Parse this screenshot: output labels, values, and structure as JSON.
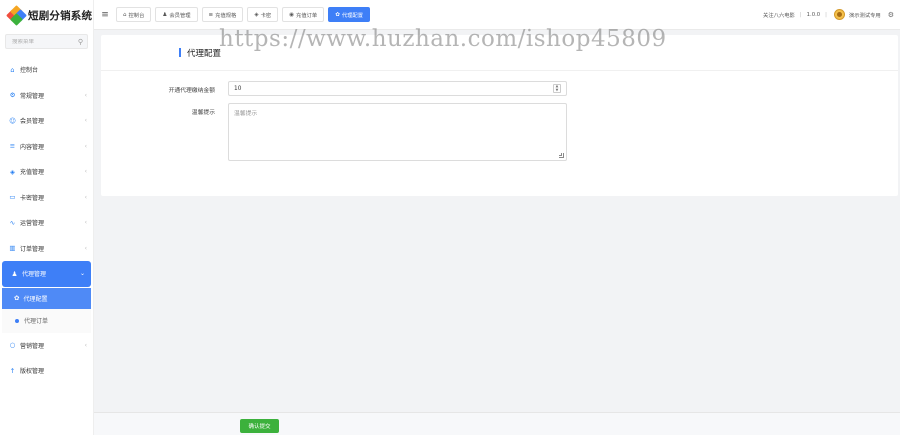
{
  "app": {
    "title": "短剧分销系统",
    "logo_colors": [
      "#f04e3e",
      "#f5a623",
      "#3e7ff7",
      "#3cb13c"
    ]
  },
  "sidebar": {
    "search_placeholder": "搜索菜单",
    "items": [
      {
        "label": "控制台",
        "icon": "home-icon",
        "glyph": "⌂",
        "has_children": false
      },
      {
        "label": "常规管理",
        "icon": "cogs-icon",
        "glyph": "⚙",
        "has_children": true
      },
      {
        "label": "会员管理",
        "icon": "user-icon",
        "glyph": "☺",
        "has_children": true
      },
      {
        "label": "内容管理",
        "icon": "list-icon",
        "glyph": "≡",
        "has_children": true
      },
      {
        "label": "充值管理",
        "icon": "diamond-icon",
        "glyph": "◈",
        "has_children": true
      },
      {
        "label": "卡密管理",
        "icon": "card-icon",
        "glyph": "▭",
        "has_children": true
      },
      {
        "label": "运营管理",
        "icon": "chart-line-icon",
        "glyph": "∿",
        "has_children": true
      },
      {
        "label": "订单管理",
        "icon": "bar-chart-icon",
        "glyph": "▥",
        "has_children": true
      }
    ],
    "active_group": {
      "label": "代理管理",
      "icon": "users-icon",
      "glyph": "♟",
      "children": [
        {
          "label": "代理配置",
          "icon": "gear-icon",
          "glyph": "✿"
        },
        {
          "label": "代理订单",
          "icon": "dot-icon"
        }
      ]
    },
    "after_items": [
      {
        "label": "营销管理",
        "icon": "circle-icon",
        "glyph": "○",
        "has_children": true
      },
      {
        "label": "版权管理",
        "icon": "arrow-up-icon",
        "glyph": "↑",
        "has_children": false
      }
    ]
  },
  "header": {
    "menu_glyph": "≡",
    "tabs": [
      {
        "label": "控制台",
        "glyph": "⌂",
        "active": false
      },
      {
        "label": "会员管理",
        "glyph": "♟",
        "active": false
      },
      {
        "label": "充值规格",
        "glyph": "≡",
        "active": false
      },
      {
        "label": "卡密",
        "glyph": "◈",
        "active": false
      },
      {
        "label": "充值订单",
        "glyph": "◉",
        "active": false
      },
      {
        "label": "代理配置",
        "glyph": "✿",
        "active": true
      }
    ],
    "right": {
      "link": "关注八六电影",
      "version": "1.0.0",
      "user": "演示测试专用"
    }
  },
  "watermark": "https://www.huzhan.com/ishop45809",
  "panel": {
    "title": "代理配置",
    "fields": {
      "amount_label": "开通代理缴纳金额",
      "amount_value": "10",
      "tip_label": "温馨提示",
      "tip_value": "温馨提示"
    }
  },
  "footer": {
    "submit_label": "确认提交"
  },
  "colors": {
    "primary": "#3e7ff7",
    "success": "#3cb13c",
    "background": "#f2f3f5"
  }
}
